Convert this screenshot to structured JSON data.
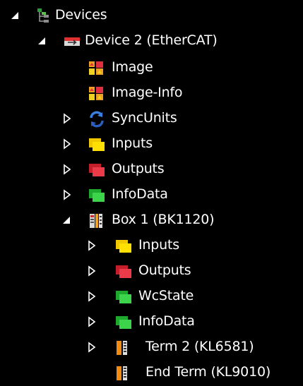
{
  "tree": {
    "nodes": [
      {
        "label": "Devices",
        "toggle": "expanded",
        "icon": "devices-icon"
      },
      {
        "label": "Device 2 (EtherCAT)",
        "toggle": "expanded",
        "icon": "ethercat-device-icon"
      },
      {
        "label": "Image",
        "toggle": "none",
        "icon": "image-icon"
      },
      {
        "label": "Image-Info",
        "toggle": "none",
        "icon": "image-info-icon"
      },
      {
        "label": "SyncUnits",
        "toggle": "collapsed",
        "icon": "sync-icon"
      },
      {
        "label": "Inputs",
        "toggle": "collapsed",
        "icon": "inputs-icon"
      },
      {
        "label": "Outputs",
        "toggle": "collapsed",
        "icon": "outputs-icon"
      },
      {
        "label": "InfoData",
        "toggle": "collapsed",
        "icon": "infodata-icon"
      },
      {
        "label": "Box 1 (BK1120)",
        "toggle": "expanded",
        "icon": "box-icon"
      },
      {
        "label": "Inputs",
        "toggle": "collapsed",
        "icon": "inputs-icon"
      },
      {
        "label": "Outputs",
        "toggle": "collapsed",
        "icon": "outputs-icon"
      },
      {
        "label": "WcState",
        "toggle": "collapsed",
        "icon": "wcstate-icon"
      },
      {
        "label": "InfoData",
        "toggle": "collapsed",
        "icon": "infodata-icon"
      },
      {
        "label": "Term 2 (KL6581)",
        "toggle": "collapsed",
        "icon": "terminal-icon"
      },
      {
        "label": "End Term (KL9010)",
        "toggle": "none",
        "icon": "terminal-icon"
      }
    ]
  }
}
